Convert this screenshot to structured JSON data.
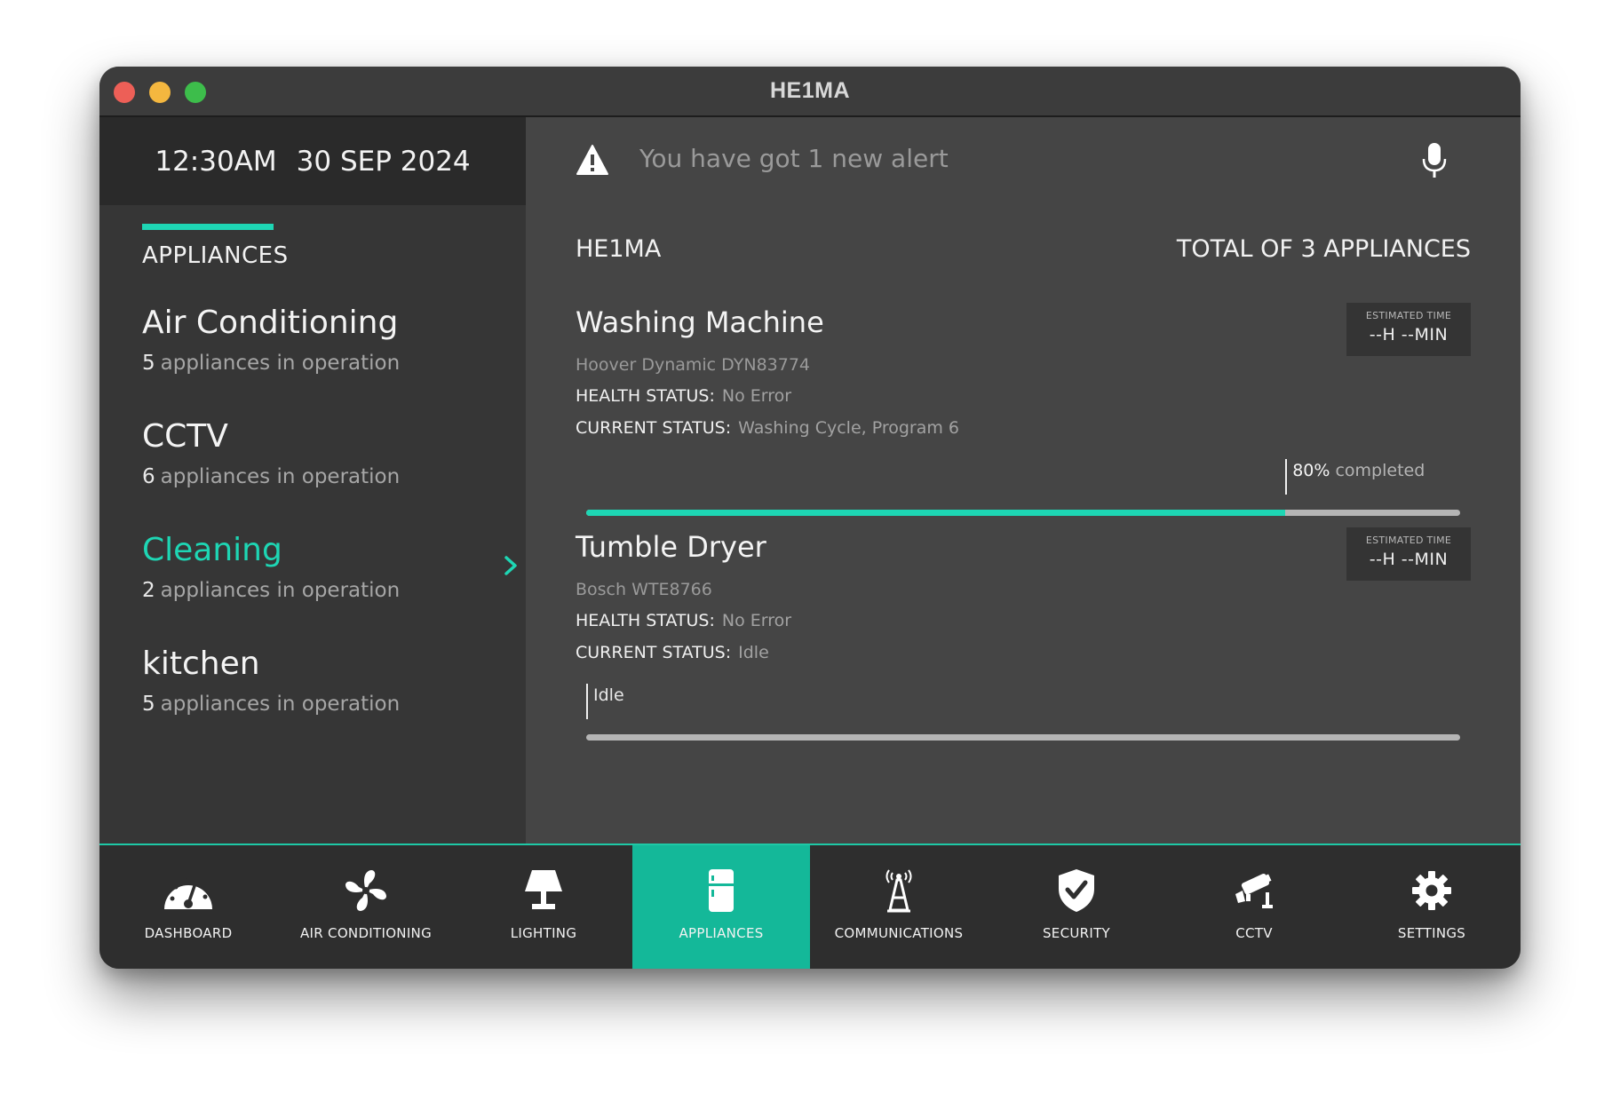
{
  "window": {
    "title": "HE1MA"
  },
  "sidebar": {
    "time": "12:30AM",
    "date": "30 SEP 2024",
    "heading": "APPLIANCES",
    "categories": [
      {
        "title": "Air Conditioning",
        "count": "5",
        "suffix": "appliances in operation"
      },
      {
        "title": "CCTV",
        "count": "6",
        "suffix": "appliances in operation"
      },
      {
        "title": "Cleaning",
        "count": "2",
        "suffix": "appliances in operation",
        "active": true
      },
      {
        "title": "kitchen",
        "count": "5",
        "suffix": "appliances in operation"
      }
    ]
  },
  "alert": {
    "text": "You have got 1 new alert",
    "icon": "warning-icon",
    "mic_icon": "microphone-icon"
  },
  "main": {
    "brand": "HE1MA",
    "total": "TOTAL OF 3 APPLIANCES",
    "appliances": [
      {
        "title": "Washing Machine",
        "model": "Hoover Dynamic DYN83774",
        "health_label": "HEALTH STATUS:",
        "health_value": "No Error",
        "status_label": "CURRENT STATUS:",
        "status_value": "Washing Cycle, Program 6",
        "est_label": "ESTIMATED TIME",
        "est_value": "--H --MIN",
        "progress_percent": 80,
        "progress_pct_text": "80%",
        "progress_rest_text": " completed"
      },
      {
        "title": "Tumble Dryer",
        "model": "Bosch WTE8766",
        "health_label": "HEALTH STATUS:",
        "health_value": "No Error",
        "status_label": "CURRENT STATUS:",
        "status_value": "Idle",
        "est_label": "ESTIMATED TIME",
        "est_value": "--H --MIN",
        "progress_percent": 0,
        "progress_text": "Idle"
      }
    ]
  },
  "nav": {
    "items": [
      {
        "label": "DASHBOARD",
        "icon": "dashboard-gauge-icon"
      },
      {
        "label": "AIR CONDITIONING",
        "icon": "fan-icon"
      },
      {
        "label": "LIGHTING",
        "icon": "lamp-icon"
      },
      {
        "label": "APPLIANCES",
        "icon": "fridge-icon",
        "active": true
      },
      {
        "label": "COMMUNICATIONS",
        "icon": "antenna-tower-icon"
      },
      {
        "label": "SECURITY",
        "icon": "shield-check-icon"
      },
      {
        "label": "CCTV",
        "icon": "security-camera-icon"
      },
      {
        "label": "SETTINGS",
        "icon": "gear-icon"
      }
    ]
  },
  "colors": {
    "accent": "#1ed6b4",
    "nav_active": "#14b899",
    "panel": "#454545",
    "sidebar": "#363636"
  }
}
